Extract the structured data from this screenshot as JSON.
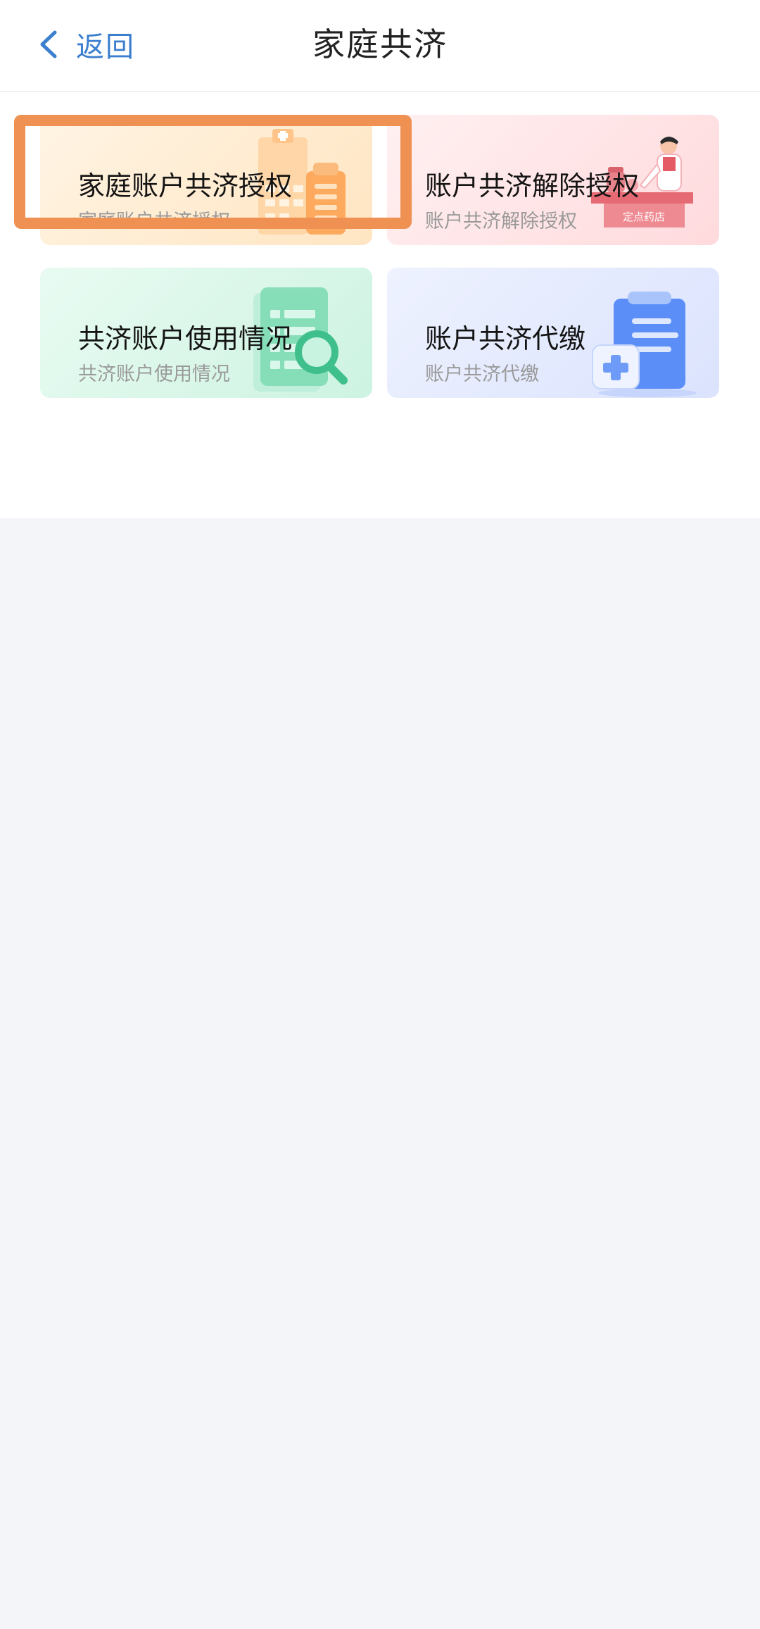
{
  "header": {
    "back_label": "返回",
    "title": "家庭共济"
  },
  "cards": [
    {
      "title": "家庭账户共济授权",
      "subtitle": "家庭账户共济授权",
      "icon": "building-icon"
    },
    {
      "title": "账户共济解除授权",
      "subtitle": "账户共济解除授权",
      "icon": "pharmacy-icon",
      "sign_text": "定点药店"
    },
    {
      "title": "共济账户使用情况",
      "subtitle": "共济账户使用情况",
      "icon": "document-search-icon"
    },
    {
      "title": "账户共济代缴",
      "subtitle": "账户共济代缴",
      "icon": "medical-clipboard-icon"
    }
  ],
  "colors": {
    "accent_blue": "#3c7fcf",
    "highlight_orange": "#ef9152"
  }
}
